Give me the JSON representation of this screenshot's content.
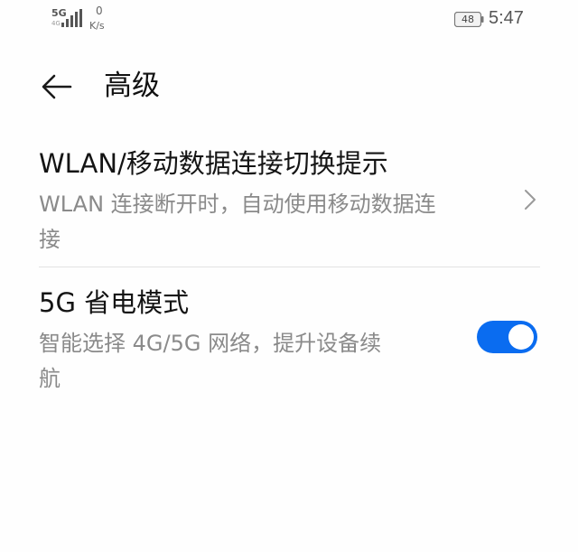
{
  "status_bar": {
    "network_type": "5G",
    "network_sub": "4G",
    "speed_value": "0",
    "speed_unit": "K/s",
    "battery_level": "48",
    "time": "5:47"
  },
  "header": {
    "title": "高级",
    "back_icon": "arrow-left-icon"
  },
  "settings": [
    {
      "title": "WLAN/移动数据连接切换提示",
      "summary_line1": "WLAN 连接断开时，自动使用移动数据连",
      "summary_line2": "接",
      "control": "chevron-right-icon"
    },
    {
      "title": "5G 省电模式",
      "summary_line1": "智能选择 4G/5G 网络，提升设备续",
      "summary_line2": "航",
      "control": "toggle",
      "enabled": true
    }
  ],
  "colors": {
    "accent": "#0a6cf0",
    "title_text": "#141414",
    "summary_text": "#8a8a8a",
    "divider": "#e3e3e3"
  }
}
